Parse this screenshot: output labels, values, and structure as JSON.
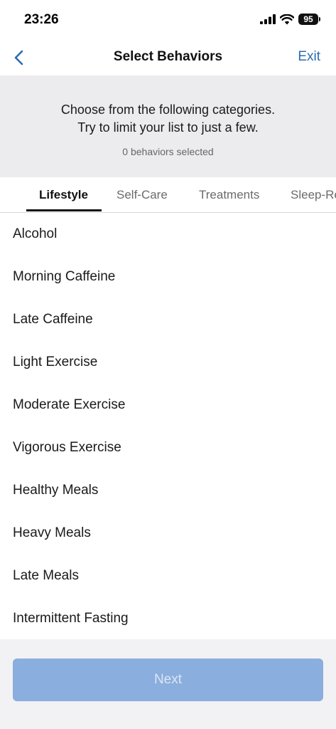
{
  "status": {
    "time": "23:26",
    "battery": "95"
  },
  "nav": {
    "title": "Select Behaviors",
    "exit_label": "Exit"
  },
  "intro": {
    "line1": "Choose from the following categories.",
    "line2": "Try to limit your list to just a few.",
    "count": "0 behaviors selected"
  },
  "tabs": [
    {
      "label": "Lifestyle",
      "active": true
    },
    {
      "label": "Self-Care",
      "active": false
    },
    {
      "label": "Treatments",
      "active": false
    },
    {
      "label": "Sleep-Re",
      "active": false
    }
  ],
  "behaviors": [
    "Alcohol",
    "Morning Caffeine",
    "Late Caffeine",
    "Light Exercise",
    "Moderate Exercise",
    "Vigorous Exercise",
    "Healthy Meals",
    "Heavy Meals",
    "Late Meals",
    "Intermittent Fasting"
  ],
  "footer": {
    "next_label": "Next"
  },
  "colors": {
    "accent": "#2b6cb0",
    "next_button": "#8aaedd",
    "intro_bg": "#ececee"
  },
  "icons": {
    "back": "chevron-left-icon",
    "signal": "cellular-signal-icon",
    "wifi": "wifi-icon",
    "battery": "battery-icon"
  }
}
